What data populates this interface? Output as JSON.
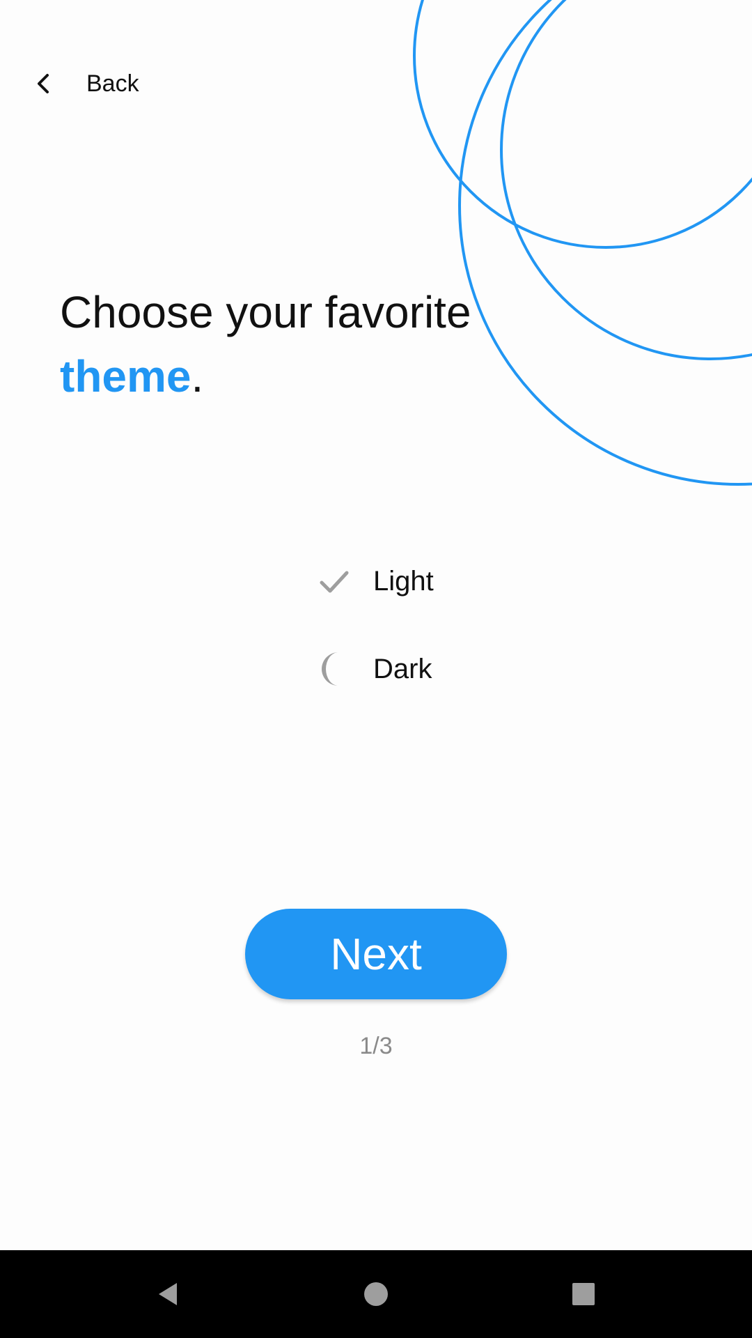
{
  "header": {
    "back_label": "Back"
  },
  "headline": {
    "line1": "Choose your favorite",
    "accent": "theme",
    "suffix": "."
  },
  "theme_options": [
    {
      "label": "Light",
      "icon": "check-icon",
      "selected": true
    },
    {
      "label": "Dark",
      "icon": "moon-icon",
      "selected": false
    }
  ],
  "actions": {
    "next_label": "Next"
  },
  "pager": {
    "text": "1/3"
  },
  "colors": {
    "accent": "#2196f3",
    "text": "#111111",
    "muted": "#8a8a8a",
    "icon_gray": "#9e9e9e",
    "background": "#fdfdfd",
    "navbar": "#000000"
  },
  "system_nav": {
    "back": "nav-back-icon",
    "home": "nav-home-icon",
    "recents": "nav-recents-icon"
  }
}
